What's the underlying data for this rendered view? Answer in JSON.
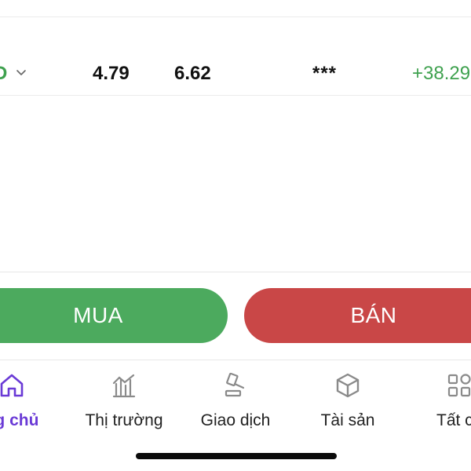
{
  "colors": {
    "buy": "#4caa5e",
    "sell": "#c94747",
    "positive": "#3fa14f",
    "accent": "#6a3ad6",
    "inactive_icon": "#8a8a8a"
  },
  "asset_row": {
    "name_fragment": "D",
    "value1": "4.79",
    "value2": "6.62",
    "hidden": "***",
    "change": "+38.29"
  },
  "actions": {
    "buy_label": "MUA",
    "sell_label": "BÁN"
  },
  "tabbar": {
    "items": [
      {
        "label": "ng chủ",
        "icon": "home-icon",
        "active": true
      },
      {
        "label": "Thị trường",
        "icon": "market-chart-icon",
        "active": false
      },
      {
        "label": "Giao dịch",
        "icon": "gavel-icon",
        "active": false
      },
      {
        "label": "Tài sản",
        "icon": "cube-icon",
        "active": false
      },
      {
        "label": "Tất c",
        "icon": "grid-icon",
        "active": false
      }
    ]
  }
}
